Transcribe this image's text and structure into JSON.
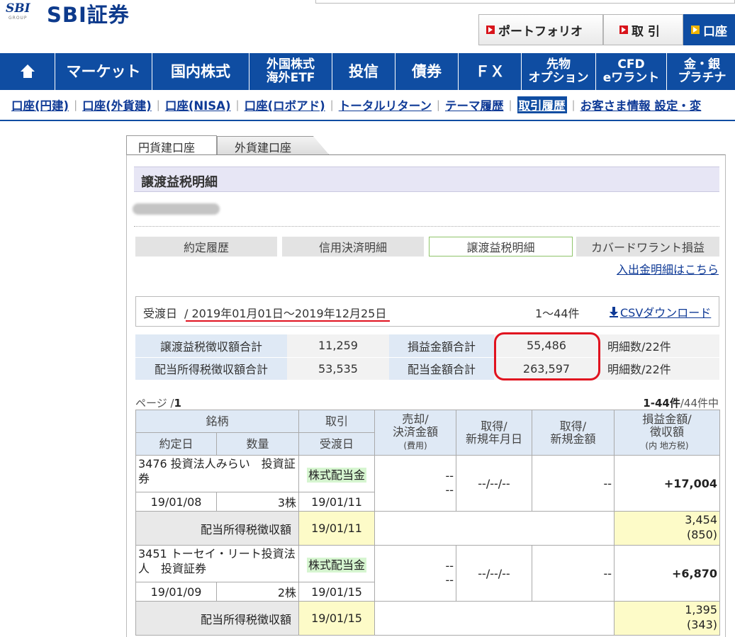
{
  "header": {
    "logo_small": "SBI",
    "logo_group": "GROUP",
    "logo_text": "SBI証券",
    "buttons": [
      "ポートフォリオ",
      "取 引",
      "口座"
    ]
  },
  "global_nav": [
    {
      "label": "",
      "icon": "home-icon"
    },
    {
      "label": "マーケット"
    },
    {
      "label": "国内株式"
    },
    {
      "label": "外国株式\n海外ETF"
    },
    {
      "label": "投信"
    },
    {
      "label": "債券"
    },
    {
      "label": "ＦＸ"
    },
    {
      "label": "先物\nオプション"
    },
    {
      "label": "CFD\neワラント"
    },
    {
      "label": "金・銀\nプラチナ"
    }
  ],
  "sub_nav": [
    {
      "label": "口座(円建)"
    },
    {
      "label": "口座(外貨建)"
    },
    {
      "label": "口座(NISA)"
    },
    {
      "label": "口座(ロボアド)"
    },
    {
      "label": "トータルリターン"
    },
    {
      "label": "テーマ履歴"
    },
    {
      "label": "取引履歴",
      "active": true
    },
    {
      "label": "お客さま情報 設定・変"
    }
  ],
  "account_tabs": [
    "円貨建口座",
    "外貨建口座"
  ],
  "section_title": "譲渡益税明細",
  "sub_tabs": [
    {
      "label": "約定履歴"
    },
    {
      "label": "信用決済明細"
    },
    {
      "label": "譲渡益税明細",
      "active": true
    },
    {
      "label": "カバードワラント損益"
    }
  ],
  "deposit_link": "入出金明細はこちら",
  "date_filter": {
    "label": "受渡日",
    "range": "/ 2019年01月01日～2019年12月25日",
    "count": "1～44件",
    "csv": "CSVダウンロード"
  },
  "summary": [
    {
      "label1": "譲渡益税徴収額合計",
      "value1": "11,259",
      "label2": "損益金額合計",
      "value2": "55,486",
      "note": "明細数/22件"
    },
    {
      "label1": "配当所得税徴収額合計",
      "value1": "53,535",
      "label2": "配当金額合計",
      "value2": "263,597",
      "note": "明細数/22件"
    }
  ],
  "pagination": {
    "page_label": "ページ /",
    "page": "1",
    "count_num": "1-44件",
    "count_total": "/44件中"
  },
  "table_header": {
    "meigara": "銘柄",
    "torihiki": "取引",
    "baikyaku": "売却/\n決済金額",
    "baikyaku_sub": "(費用)",
    "shutoku_date": "取得/\n新規年月日",
    "shutoku_amount": "取得/\n新規金額",
    "soneki": "損益金額/\n徴収額",
    "soneki_sub": "(内 地方税)",
    "yakujo": "約定日",
    "suryo": "数量",
    "ukewatashi": "受渡日"
  },
  "rows": [
    {
      "name": "3476 投資法人みらい　投資証券",
      "kind": "株式配当金",
      "sell1": "--",
      "sell2": "--",
      "acq_date": "--/--/--",
      "acq_amount": "--",
      "profit": "+17,004",
      "trade_date": "19/01/08",
      "qty": "3株",
      "settle_date": "19/01/11",
      "tax_label": "配当所得税徴収額",
      "tax_date": "19/01/11",
      "tax_amount": "3,454",
      "tax_local": "(850)"
    },
    {
      "name": "3451 トーセイ・リート投資法人　投資証券",
      "kind": "株式配当金",
      "sell1": "--",
      "sell2": "--",
      "acq_date": "--/--/--",
      "acq_amount": "--",
      "profit": "+6,870",
      "trade_date": "19/01/09",
      "qty": "2株",
      "settle_date": "19/01/15",
      "tax_label": "配当所得税徴収額",
      "tax_date": "19/01/15",
      "tax_amount": "1,395",
      "tax_local": "(343)"
    }
  ],
  "colors": {
    "brand_blue": "#0f4da2",
    "link_blue": "#0f3a96",
    "accent_red": "#e0121f",
    "header_bg": "#dfe9f5"
  }
}
